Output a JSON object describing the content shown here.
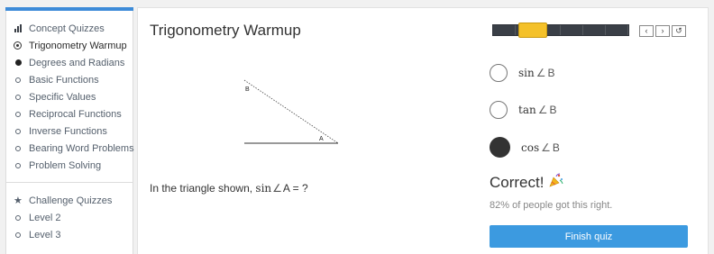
{
  "sidebar": {
    "concept_header": "Concept Quizzes",
    "concept_items": [
      {
        "label": "Trigonometry Warmup",
        "state": "current"
      },
      {
        "label": "Degrees and Radians",
        "state": "done"
      },
      {
        "label": "Basic Functions",
        "state": "todo"
      },
      {
        "label": "Specific Values",
        "state": "todo"
      },
      {
        "label": "Reciprocal Functions",
        "state": "todo"
      },
      {
        "label": "Inverse Functions",
        "state": "todo"
      },
      {
        "label": "Bearing Word Problems",
        "state": "todo"
      },
      {
        "label": "Problem Solving",
        "state": "todo"
      }
    ],
    "challenge_header": "Challenge Quizzes",
    "challenge_items": [
      {
        "label": "Level 2"
      },
      {
        "label": "Level 3"
      }
    ]
  },
  "quiz": {
    "title": "Trigonometry Warmup",
    "figure": {
      "vertex_b": "B",
      "vertex_a": "A"
    },
    "question": {
      "prefix": "In the triangle shown,",
      "fn": "sin",
      "angle": "∠",
      "point": "A",
      "suffix": "= ?"
    }
  },
  "progress": {
    "segments": 6,
    "current_segment": 2
  },
  "nav": {
    "prev": "‹",
    "next": "›",
    "reset": "↺"
  },
  "options": [
    {
      "fn": "sin",
      "angle": "∠",
      "point": "B",
      "selected": false
    },
    {
      "fn": "tan",
      "angle": "∠",
      "point": "B",
      "selected": false
    },
    {
      "fn": "cos",
      "angle": "∠",
      "point": "B",
      "selected": true
    }
  ],
  "result": {
    "title": "Correct!",
    "icon": "party-popper-icon",
    "subtitle": "82% of people got this right.",
    "percent_correct": 82
  },
  "finish_button": "Finish quiz",
  "colors": {
    "accent": "#3c9ae0",
    "progress_handle": "#f4c12a",
    "progress_track": "#3a3f47"
  }
}
